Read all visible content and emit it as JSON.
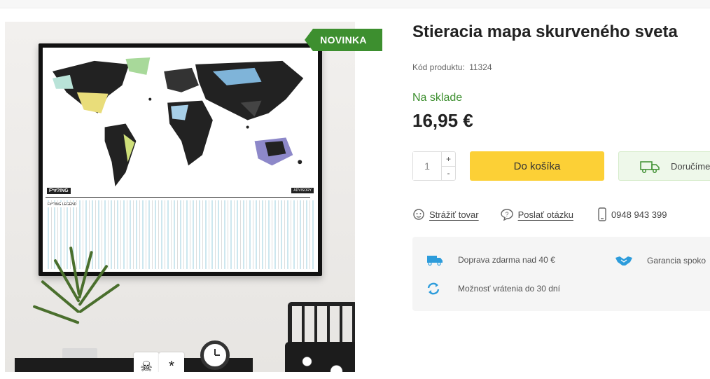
{
  "badge": {
    "label": "NOVINKA"
  },
  "poster": {
    "brand": "F*#?ING",
    "advisory": "ADVISORY",
    "legend_title": "F#*?ING LEGEND"
  },
  "mugs": [
    "☠",
    "*"
  ],
  "product": {
    "title": "Stieracia mapa skurveného sveta",
    "code_label": "Kód produktu:",
    "code_value": "11324",
    "stock": "Na sklade",
    "price": "16,95 €"
  },
  "quantity": {
    "value": "1",
    "plus": "+",
    "minus": "-"
  },
  "buttons": {
    "add_to_cart": "Do košíka",
    "delivery": "Doručíme"
  },
  "links": {
    "watch": "Strážiť tovar",
    "ask": "Poslať otázku",
    "phone": "0948 943 399"
  },
  "benefits": [
    {
      "label": "Doprava zdarma nad 40 €",
      "icon": "truck-icon"
    },
    {
      "label": "Garancia spoko",
      "icon": "handshake-icon"
    },
    {
      "label": "Možnosť vrátenia do 30 dní",
      "icon": "refresh-icon"
    }
  ],
  "colors": {
    "green": "#3d8f2f",
    "yellow": "#fcd036",
    "blue": "#2d9cdb"
  }
}
